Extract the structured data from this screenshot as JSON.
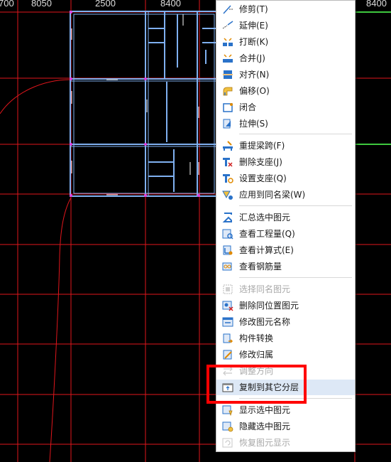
{
  "ruler": {
    "labels": [
      "700",
      "8050",
      "2500",
      "8400",
      "8400"
    ]
  },
  "menu": {
    "items": [
      {
        "label": "修剪(T)",
        "icon": "trim-icon",
        "enabled": true
      },
      {
        "label": "延伸(E)",
        "icon": "extend-icon",
        "enabled": true
      },
      {
        "label": "打断(K)",
        "icon": "break-icon",
        "enabled": true
      },
      {
        "label": "合并(J)",
        "icon": "merge-icon",
        "enabled": true
      },
      {
        "label": "对齐(N)",
        "icon": "align-icon",
        "enabled": true
      },
      {
        "label": "偏移(O)",
        "icon": "offset-icon",
        "enabled": true
      },
      {
        "label": "闭合",
        "icon": "close-shape-icon",
        "enabled": true
      },
      {
        "label": "拉伸(S)",
        "icon": "stretch-icon",
        "enabled": true
      },
      {
        "label": "重提梁跨(F)",
        "icon": "beam-span-icon",
        "enabled": true
      },
      {
        "label": "删除支座(J)",
        "icon": "delete-support-icon",
        "enabled": true
      },
      {
        "label": "设置支座(Q)",
        "icon": "set-support-icon",
        "enabled": true
      },
      {
        "label": "应用到同名梁(W)",
        "icon": "apply-same-beam-icon",
        "enabled": true
      },
      {
        "label": "汇总选中图元",
        "icon": "sigma-icon",
        "enabled": true
      },
      {
        "label": "查看工程量(Q)",
        "icon": "view-quantity-icon",
        "enabled": true
      },
      {
        "label": "查看计算式(E)",
        "icon": "view-formula-icon",
        "enabled": true
      },
      {
        "label": "查看钢筋量",
        "icon": "view-rebar-icon",
        "enabled": true
      },
      {
        "label": "选择同名图元",
        "icon": "select-same-name-icon",
        "enabled": false
      },
      {
        "label": "删除同位置图元",
        "icon": "delete-same-position-icon",
        "enabled": true
      },
      {
        "label": "修改图元名称",
        "icon": "rename-element-icon",
        "enabled": true
      },
      {
        "label": "构件转换",
        "icon": "convert-component-icon",
        "enabled": true
      },
      {
        "label": "修改归属",
        "icon": "edit-ownership-icon",
        "enabled": true
      },
      {
        "label": "调整方向",
        "icon": "adjust-direction-icon",
        "enabled": false
      },
      {
        "label": "复制到其它分层",
        "icon": "copy-to-layer-icon",
        "enabled": true,
        "hovered": true
      },
      {
        "label": "显示选中图元",
        "icon": "show-element-icon",
        "enabled": true
      },
      {
        "label": "隐藏选中图元",
        "icon": "hide-element-icon",
        "enabled": true
      },
      {
        "label": "恢复图元显示",
        "icon": "restore-display-icon",
        "enabled": false
      }
    ]
  },
  "colors": {
    "grid": "#e0161c",
    "wall": "#7fb0f0",
    "beam_green": "#3ec83e",
    "highlight_box": "#ff0000",
    "hover_bg": "#dde8f6",
    "disabled_text": "#a8a8a8"
  }
}
